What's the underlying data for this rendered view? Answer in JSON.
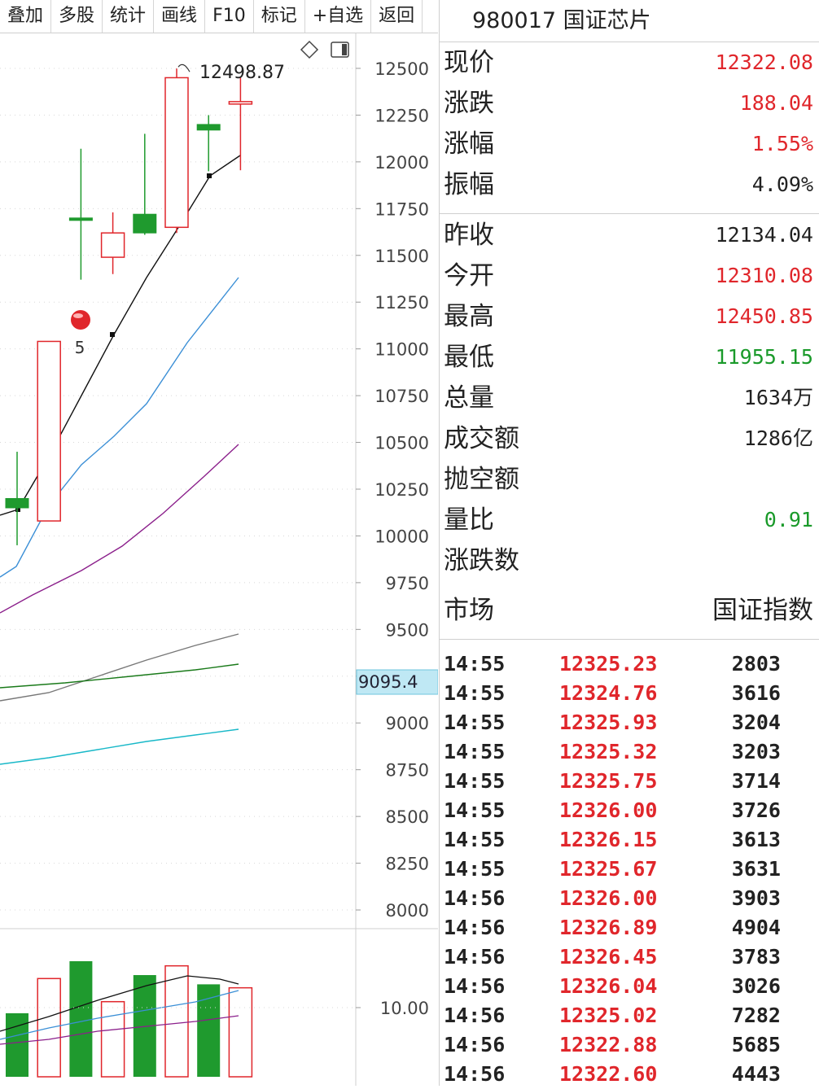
{
  "toolbar": {
    "buttons": [
      "叠加",
      "多股",
      "统计",
      "画线",
      "F10",
      "标记",
      "+自选",
      "返回"
    ]
  },
  "chart": {
    "y_axis_ticks": [
      "12500",
      "12250",
      "12000",
      "11750",
      "11500",
      "11250",
      "11000",
      "10750",
      "10500",
      "10250",
      "10000",
      "9750",
      "9500",
      "9250",
      "9000",
      "8750",
      "8500",
      "8250",
      "8000"
    ],
    "high_annotation": "12498.87",
    "current_marker": "9095.4",
    "volume_axis_label": "10.00",
    "event_badge_label": "5",
    "colors": {
      "up": "#e0262b",
      "down": "#1f9a2e",
      "ma_black": "#111111",
      "ma_blue": "#3b8fd6",
      "ma_purple": "#8b1f8b",
      "ma_gray": "#777777",
      "ma_green": "#1a7a1a",
      "ma_cyan": "#18b8c8"
    },
    "icons": [
      "diamond-icon",
      "panel-toggle-icon"
    ]
  },
  "chart_data": {
    "type": "candlestick",
    "ylim": [
      7900,
      12600
    ],
    "candles": [
      {
        "open": 10200,
        "close": 10150,
        "high": 10450,
        "low": 9950,
        "dir": "down"
      },
      {
        "open": 10080,
        "close": 11040,
        "high": 11040,
        "low": 10080,
        "dir": "up"
      },
      {
        "open": 11700,
        "close": 11700,
        "high": 12070,
        "low": 11370,
        "dir": "down"
      },
      {
        "open": 11490,
        "close": 11620,
        "high": 11730,
        "low": 11400,
        "dir": "up"
      },
      {
        "open": 11720,
        "close": 11620,
        "high": 12150,
        "low": 11610,
        "dir": "down"
      },
      {
        "open": 11650,
        "close": 12450,
        "high": 12498.87,
        "low": 11620,
        "dir": "up"
      },
      {
        "open": 12200,
        "close": 12170,
        "high": 12250,
        "low": 11950,
        "dir": "down"
      },
      {
        "open": 12310.08,
        "close": 12322.08,
        "high": 12450.85,
        "low": 11955.15,
        "dir": "up"
      }
    ],
    "volumes": [
      {
        "v": 0.55,
        "dir": "down"
      },
      {
        "v": 0.85,
        "dir": "up"
      },
      {
        "v": 1.0,
        "dir": "down"
      },
      {
        "v": 0.65,
        "dir": "up"
      },
      {
        "v": 0.88,
        "dir": "down"
      },
      {
        "v": 0.96,
        "dir": "up"
      },
      {
        "v": 0.8,
        "dir": "down"
      },
      {
        "v": 0.77,
        "dir": "up"
      }
    ]
  },
  "quote": {
    "code_name": "980017 国证芯片",
    "rows": [
      {
        "label": "现价",
        "value": "12322.08",
        "color": "red"
      },
      {
        "label": "涨跌",
        "value": "188.04",
        "color": "red"
      },
      {
        "label": "涨幅",
        "value": "1.55%",
        "color": "red"
      },
      {
        "label": "振幅",
        "value": "4.09%",
        "color": "dark"
      },
      {
        "label": "昨收",
        "value": "12134.04",
        "color": "dark"
      },
      {
        "label": "今开",
        "value": "12310.08",
        "color": "red"
      },
      {
        "label": "最高",
        "value": "12450.85",
        "color": "red"
      },
      {
        "label": "最低",
        "value": "11955.15",
        "color": "green"
      },
      {
        "label": "总量",
        "value": "1634万",
        "color": "dark"
      },
      {
        "label": "成交额",
        "value": "1286亿",
        "color": "dark"
      },
      {
        "label": "抛空额",
        "value": "",
        "color": "dark"
      },
      {
        "label": "量比",
        "value": "0.91",
        "color": "green"
      },
      {
        "label": "涨跌数",
        "value": "",
        "color": "dark"
      }
    ],
    "market_label": "市场",
    "market_value": "国证指数"
  },
  "ticks": [
    {
      "time": "14:55",
      "price": "12325.23",
      "vol": "2803"
    },
    {
      "time": "14:55",
      "price": "12324.76",
      "vol": "3616"
    },
    {
      "time": "14:55",
      "price": "12325.93",
      "vol": "3204"
    },
    {
      "time": "14:55",
      "price": "12325.32",
      "vol": "3203"
    },
    {
      "time": "14:55",
      "price": "12325.75",
      "vol": "3714"
    },
    {
      "time": "14:55",
      "price": "12326.00",
      "vol": "3726"
    },
    {
      "time": "14:55",
      "price": "12326.15",
      "vol": "3613"
    },
    {
      "time": "14:55",
      "price": "12325.67",
      "vol": "3631"
    },
    {
      "time": "14:56",
      "price": "12326.00",
      "vol": "3903"
    },
    {
      "time": "14:56",
      "price": "12326.89",
      "vol": "4904"
    },
    {
      "time": "14:56",
      "price": "12326.45",
      "vol": "3783"
    },
    {
      "time": "14:56",
      "price": "12326.04",
      "vol": "3026"
    },
    {
      "time": "14:56",
      "price": "12325.02",
      "vol": "7282"
    },
    {
      "time": "14:56",
      "price": "12322.88",
      "vol": "5685"
    },
    {
      "time": "14:56",
      "price": "12322.60",
      "vol": "4443"
    }
  ]
}
